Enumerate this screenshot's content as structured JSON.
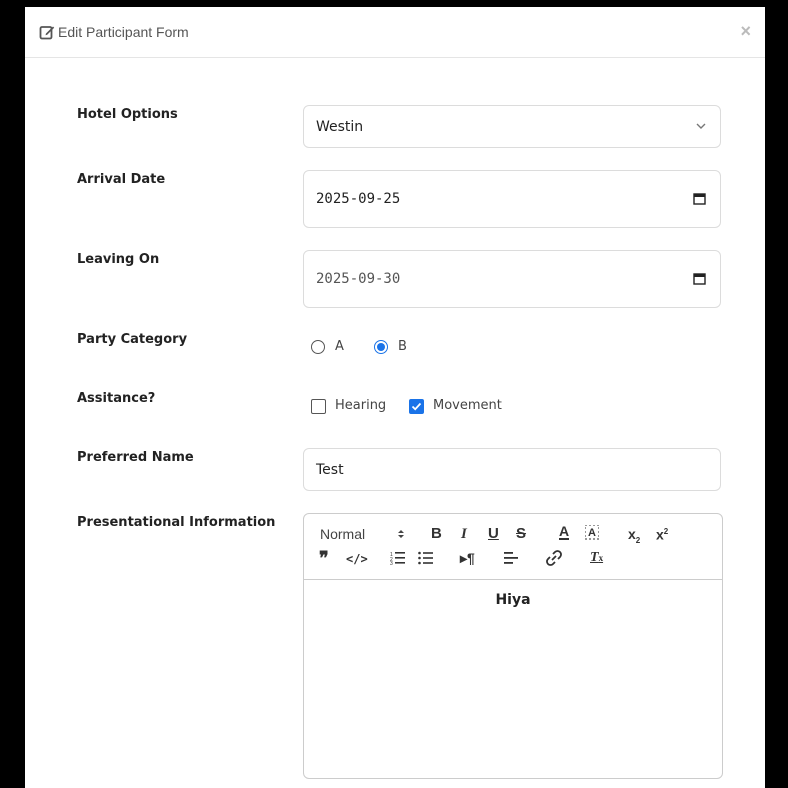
{
  "modal": {
    "title": "Edit Participant Form",
    "close_label": "×"
  },
  "form": {
    "hotel": {
      "label": "Hotel Options",
      "value": "Westin"
    },
    "arrival": {
      "label": "Arrival Date",
      "value": "2025-09-25"
    },
    "leaving": {
      "label": "Leaving On",
      "value": "2025-09-30"
    },
    "party": {
      "label": "Party Category",
      "options": [
        "A",
        "B"
      ],
      "selected": "B"
    },
    "assistance": {
      "label": "Assitance?",
      "options": [
        "Hearing",
        "Movement"
      ],
      "checked": [
        "Movement"
      ]
    },
    "preferred_name": {
      "label": "Preferred Name",
      "value": "Test"
    },
    "presentational": {
      "label": "Presentational Information",
      "heading_value": "Normal",
      "content": "Hiya"
    }
  },
  "colors": {
    "accent": "#1a73e8",
    "overlay": "#000000"
  }
}
